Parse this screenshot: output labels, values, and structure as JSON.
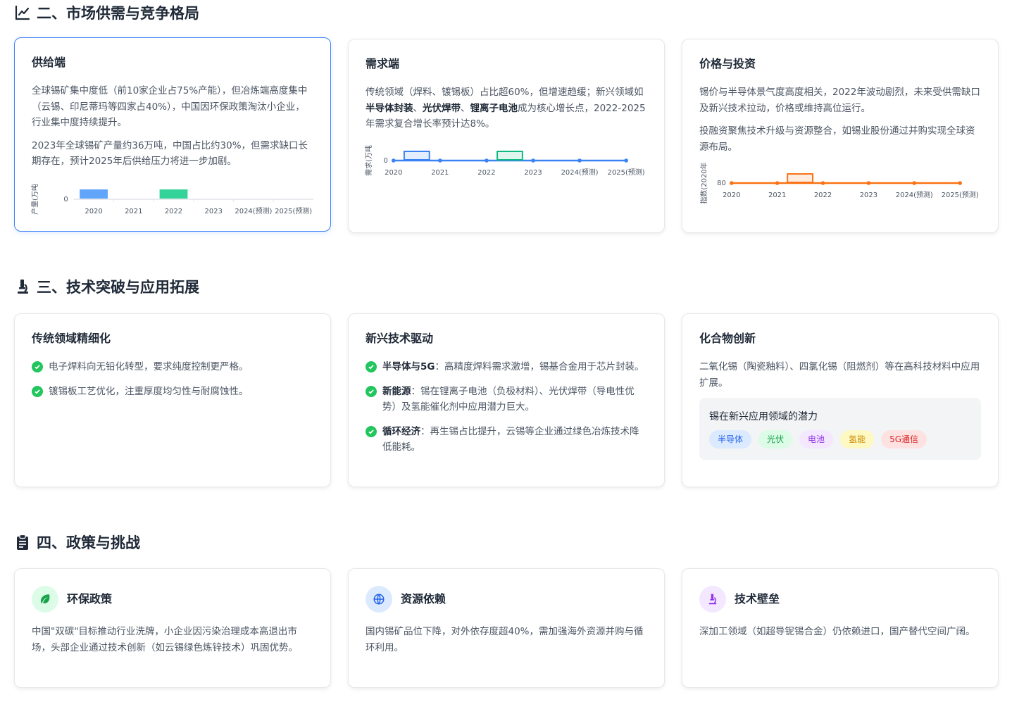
{
  "sections": {
    "market": {
      "title": "二、市场供需与竞争格局"
    },
    "tech": {
      "title": "三、技术突破与应用拓展"
    },
    "policy": {
      "title": "四、政策与挑战"
    }
  },
  "supply": {
    "title": "供给端",
    "p1": "全球锡矿集中度低（前10家企业占75%产能），但冶炼端高度集中（云锡、印尼蒂玛等四家占40%），中国因环保政策淘汰小企业，行业集中度持续提升。",
    "p2": "2023年全球锡矿产量约36万吨，中国占比约30%，但需求缺口长期存在，预计2025年后供给压力将进一步加剧。"
  },
  "demand": {
    "title": "需求端",
    "p1_a": "传统领域（焊料、镀锡板）占比超60%，但增速趋缓；新兴领域如",
    "p1_b1": "半导体封装",
    "p1_sep1": "、",
    "p1_b2": "光伏焊带",
    "p1_sep2": "、",
    "p1_b3": "锂离子电池",
    "p1_c": "成为核心增长点，2022-2025年需求复合增长率预计达8%。"
  },
  "price": {
    "title": "价格与投资",
    "p1": "锡价与半导体景气度高度相关，2022年波动剧烈，未来受供需缺口及新兴技术拉动，价格或维持高位运行。",
    "p2": "投融资聚焦技术升级与资源整合，如锡业股份通过并购实现全球资源布局。"
  },
  "chart_data": [
    {
      "type": "bar",
      "ylabel": "产量(万吨",
      "categories": [
        "2020",
        "2021",
        "2022",
        "2023",
        "2024(预测)",
        "2025(预测)"
      ],
      "y_ticks": [
        "0"
      ],
      "highlighted": [
        1,
        3
      ],
      "colors": [
        "#60a5fa",
        "#34d399"
      ]
    },
    {
      "type": "line",
      "ylabel": "需求(万吨",
      "categories": [
        "2020",
        "2021",
        "2022",
        "2023",
        "2024(预测)",
        "2025(预测)"
      ],
      "y_ticks": [
        "0"
      ],
      "highlighted": [
        1,
        3
      ],
      "colors": [
        "#3b82f6",
        "#10b981"
      ]
    },
    {
      "type": "line",
      "ylabel": "指数(2020年",
      "categories": [
        "2020",
        "2021",
        "2022",
        "2023",
        "2024(预测)",
        "2025(预测)"
      ],
      "y_ticks": [
        "80"
      ],
      "highlighted": [
        2
      ],
      "colors": [
        "#f97316"
      ]
    }
  ],
  "traditional": {
    "title": "传统领域精细化",
    "items": [
      "电子焊料向无铅化转型，要求纯度控制更严格。",
      "镀锡板工艺优化，注重厚度均匀性与耐腐蚀性。"
    ]
  },
  "emerging": {
    "title": "新兴技术驱动",
    "items": [
      {
        "b": "半导体与5G",
        "t": "：高精度焊料需求激增，锡基合金用于芯片封装。"
      },
      {
        "b": "新能源",
        "t": "：锡在锂离子电池（负极材料）、光伏焊带（导电性优势）及氢能催化剂中应用潜力巨大。"
      },
      {
        "b": "循环经济",
        "t": "：再生锡占比提升，云锡等企业通过绿色冶炼技术降低能耗。"
      }
    ]
  },
  "compound": {
    "title": "化合物创新",
    "p1": "二氧化锡（陶瓷釉料）、四氯化锡（阻燃剂）等在高科技材料中应用扩展。",
    "potential_title": "锡在新兴应用领域的潜力",
    "tags": [
      "半导体",
      "光伏",
      "电池",
      "氢能",
      "5G通信"
    ]
  },
  "policy": {
    "env": {
      "title": "环保政策",
      "p": "中国\"双碳\"目标推动行业洗牌，小企业因污染治理成本高退出市场，头部企业通过技术创新（如云锡绿色炼锌技术）巩固优势。"
    },
    "resource": {
      "title": "资源依赖",
      "p": "国内锡矿品位下降，对外依存度超40%，需加强海外资源并购与循环利用。"
    },
    "barrier": {
      "title": "技术壁垒",
      "p": "深加工领域（如超导铌锡合金）仍依赖进口，国产替代空间广阔。"
    }
  },
  "colors": {
    "accent": "#3b82f6",
    "check": "#22c55e"
  }
}
